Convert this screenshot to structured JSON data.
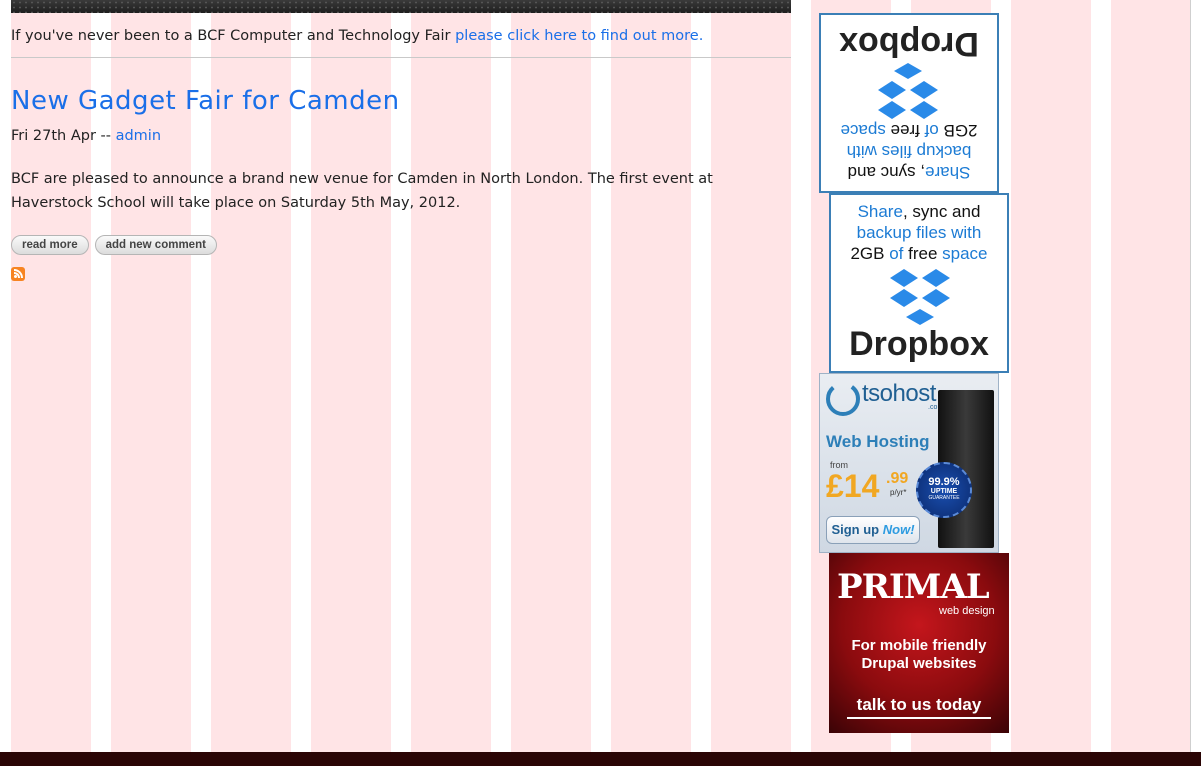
{
  "intro": {
    "text": "If you've never been to a BCF Computer and Technology Fair ",
    "link": "please click here to find out more."
  },
  "node": {
    "title": "New Gadget Fair for Camden",
    "date": "Fri 27th Apr",
    "separator": "--",
    "author": "admin",
    "body": "BCF are pleased to announce a brand new venue for Camden in North London. The first event at Haverstock School will take place on Saturday 5th May, 2012.",
    "links": {
      "read_more": "read more",
      "add_comment": "add new comment"
    }
  },
  "ads": {
    "dropbox": {
      "line1a": "Share",
      "line1b": ", sync and",
      "line2": "backup files with",
      "line3a": "2GB",
      "line3b": " of ",
      "line3c": "free",
      "line3d": " space",
      "logo": "Dropbox"
    },
    "tsohost": {
      "brand": "tsohost",
      "domain": ".co.uk",
      "headline": "Web Hosting",
      "from": "from",
      "price": "£14",
      "pence": ".99",
      "per": "p/yr*",
      "uptime": "99.9%",
      "uptime_label": "UPTIME",
      "guarantee": "GUARANTEE",
      "signup": "Sign up",
      "now": "Now!"
    },
    "primal": {
      "brand": "PRIMAL",
      "sub": "web design",
      "line1": "For mobile friendly",
      "line2": "Drupal websites",
      "cta": "talk to us today"
    }
  },
  "colors": {
    "link": "#1a6fe8",
    "stripe": "#ffe4e6",
    "footer": "#2a0505"
  }
}
